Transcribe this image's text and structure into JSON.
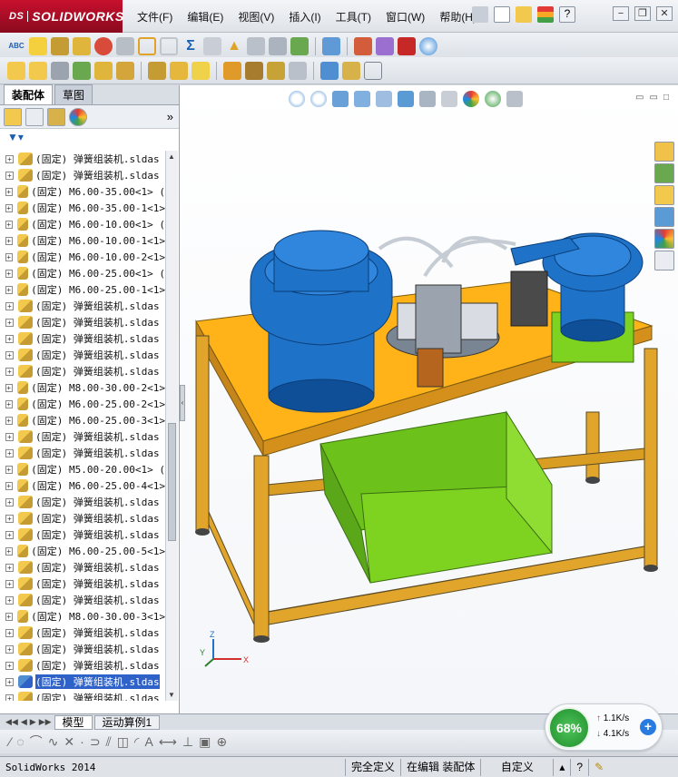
{
  "app": {
    "logo_prefix": "DS",
    "logo_text": "SOLIDWORKS",
    "status_app_name": "SolidWorks 2014"
  },
  "menu": [
    "文件(F)",
    "编辑(E)",
    "视图(V)",
    "插入(I)",
    "工具(T)",
    "窗口(W)",
    "帮助(H)"
  ],
  "title_tools": {
    "help_icon": "question-icon"
  },
  "left_panel": {
    "tabs": [
      "装配体",
      "草图"
    ],
    "active_tab": "装配体",
    "filter_icon": "filter-icon",
    "expand_more": "»",
    "tree_items": [
      "(固定) 弹簧组装机.sldas",
      "(固定) 弹簧组装机.sldas",
      "(固定) M6.00-35.00<1> (",
      "(固定) M6.00-35.00-1<1>",
      "(固定) M6.00-10.00<1> (",
      "(固定) M6.00-10.00-1<1>",
      "(固定) M6.00-10.00-2<1>",
      "(固定) M6.00-25.00<1> (",
      "(固定) M6.00-25.00-1<1>",
      "(固定) 弹簧组装机.sldas",
      "(固定) 弹簧组装机.sldas",
      "(固定) 弹簧组装机.sldas",
      "(固定) 弹簧组装机.sldas",
      "(固定) 弹簧组装机.sldas",
      "(固定) M8.00-30.00-2<1>",
      "(固定) M6.00-25.00-2<1>",
      "(固定) M6.00-25.00-3<1>",
      "(固定) 弹簧组装机.sldas",
      "(固定) 弹簧组装机.sldas",
      "(固定) M5.00-20.00<1> (",
      "(固定) M6.00-25.00-4<1>",
      "(固定) 弹簧组装机.sldas",
      "(固定) 弹簧组装机.sldas",
      "(固定) 弹簧组装机.sldas",
      "(固定) M6.00-25.00-5<1>",
      "(固定) 弹簧组装机.sldas",
      "(固定) 弹簧组装机.sldas",
      "(固定) 弹簧组装机.sldas",
      "(固定) M8.00-30.00-3<1>",
      "(固定) 弹簧组装机.sldas",
      "(固定) 弹簧组装机.sldas",
      "(固定) 弹簧组装机.sldas",
      "(固定) 弹簧组装机.sldas",
      "(固定) 弹簧组装机.sldas"
    ],
    "selected_index": 32
  },
  "bottom_tabs": [
    "模型",
    "运动算例1"
  ],
  "active_bottom_tab": "模型",
  "status": {
    "state": "完全定义",
    "editing": "在编辑 装配体",
    "units": "自定义",
    "help": "?"
  },
  "network": {
    "percent": "68%",
    "upload": "1.1K/s",
    "download": "4.1K/s",
    "plus": "+"
  },
  "triad": {
    "x": "X",
    "y": "Y",
    "z": "Z"
  },
  "colors": {
    "table_top": "#ffb319",
    "frame": "#e0a52a",
    "frame_dark": "#5a4a25",
    "bowl": "#1e73c8",
    "bowl_dark": "#0f4f98",
    "bin": "#7ed321",
    "base_green": "#7ed321",
    "logo_red": "#c8102e"
  }
}
